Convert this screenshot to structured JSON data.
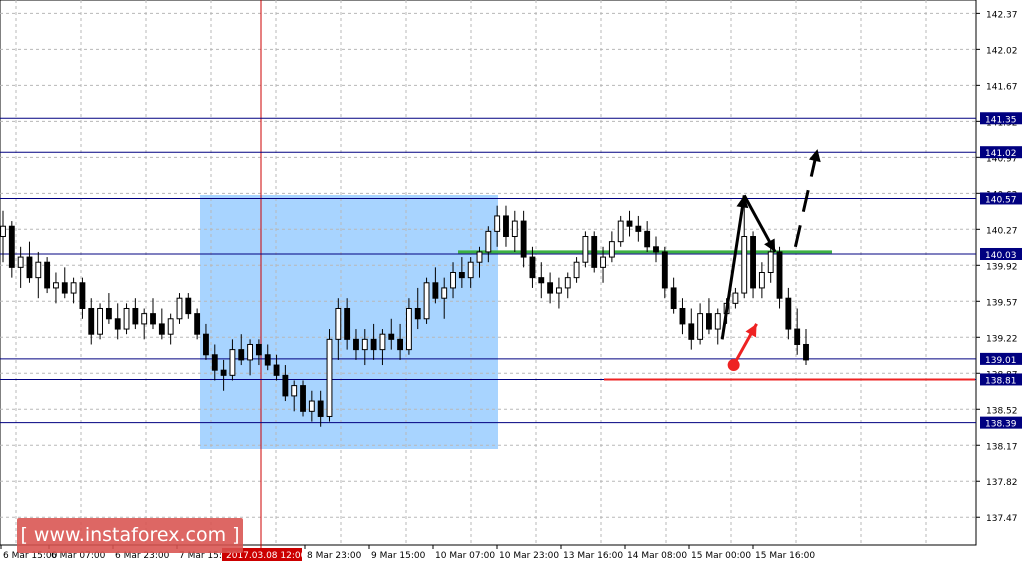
{
  "watermark": "[ www.instaforex.com ]",
  "chart_data": {
    "type": "candlestick",
    "symbol": "",
    "y_axis": {
      "min": 137.2,
      "max": 142.5,
      "ticks": [
        "142.37",
        "142.02",
        "141.67",
        "141.32",
        "140.97",
        "140.62",
        "140.27",
        "139.92",
        "139.57",
        "139.22",
        "138.87",
        "138.52",
        "138.17",
        "137.82",
        "137.47"
      ]
    },
    "x_axis": {
      "labels": [
        "6 Mar 15:00",
        "6 Mar 07:00",
        "6 Mar 23:00",
        "7 Mar 15:00",
        "8 Mar 23:00",
        "9 Mar 15:00",
        "10 Mar 07:00",
        "10 Mar 23:00",
        "13 Mar 16:00",
        "14 Mar 08:00",
        "15 Mar 00:00",
        "15 Mar 16:00"
      ],
      "highlight_label": "2017.03.08 12:00"
    },
    "horizontal_levels": [
      {
        "price": 141.35,
        "label": "141.35",
        "color": "#000080"
      },
      {
        "price": 141.02,
        "label": "141.02",
        "color": "#000080"
      },
      {
        "price": 140.57,
        "label": "140.57",
        "color": "#000080"
      },
      {
        "price": 140.03,
        "label": "140.03",
        "color": "#000080"
      },
      {
        "price": 139.01,
        "label": "139.01",
        "color": "#000080"
      },
      {
        "price": 138.81,
        "label": "138.81",
        "color": "#000080"
      },
      {
        "price": 138.39,
        "label": "138.39",
        "color": "#000080"
      }
    ],
    "green_level": {
      "price": 140.05,
      "color": "#3cb043"
    },
    "red_level": {
      "price": 138.81,
      "color": "#ee2222"
    },
    "vertical_marker_color": "#cc0000",
    "highlight_box_color": "#99ccff",
    "colors": {
      "grid": "#b8b8b8",
      "candle": "#000000",
      "axis_text": "#000000",
      "level_label_bg": "#000080",
      "level_label_text": "#ffffff"
    },
    "ohlc": [
      [
        140.2,
        140.45,
        139.95,
        140.3
      ],
      [
        140.3,
        140.35,
        139.8,
        139.9
      ],
      [
        139.9,
        140.1,
        139.7,
        140.0
      ],
      [
        140.0,
        140.15,
        139.75,
        139.8
      ],
      [
        139.8,
        140.05,
        139.6,
        139.95
      ],
      [
        139.95,
        140.0,
        139.65,
        139.7
      ],
      [
        139.7,
        139.85,
        139.55,
        139.75
      ],
      [
        139.75,
        139.9,
        139.6,
        139.65
      ],
      [
        139.65,
        139.8,
        139.55,
        139.75
      ],
      [
        139.75,
        139.8,
        139.4,
        139.5
      ],
      [
        139.5,
        139.6,
        139.15,
        139.25
      ],
      [
        139.25,
        139.55,
        139.2,
        139.5
      ],
      [
        139.5,
        139.65,
        139.35,
        139.4
      ],
      [
        139.4,
        139.55,
        139.2,
        139.3
      ],
      [
        139.3,
        139.55,
        139.25,
        139.5
      ],
      [
        139.5,
        139.6,
        139.3,
        139.35
      ],
      [
        139.35,
        139.5,
        139.2,
        139.45
      ],
      [
        139.45,
        139.6,
        139.3,
        139.35
      ],
      [
        139.35,
        139.5,
        139.2,
        139.25
      ],
      [
        139.25,
        139.45,
        139.15,
        139.4
      ],
      [
        139.4,
        139.65,
        139.35,
        139.6
      ],
      [
        139.6,
        139.65,
        139.4,
        139.45
      ],
      [
        139.45,
        139.5,
        139.2,
        139.25
      ],
      [
        139.25,
        139.35,
        139.0,
        139.05
      ],
      [
        139.05,
        139.15,
        138.8,
        138.9
      ],
      [
        138.9,
        139.0,
        138.7,
        138.85
      ],
      [
        138.85,
        139.2,
        138.8,
        139.1
      ],
      [
        139.1,
        139.25,
        138.95,
        139.0
      ],
      [
        139.0,
        139.2,
        138.85,
        139.15
      ],
      [
        139.15,
        139.2,
        138.95,
        139.05
      ],
      [
        139.05,
        139.15,
        138.9,
        138.95
      ],
      [
        138.95,
        139.05,
        138.8,
        138.85
      ],
      [
        138.85,
        138.95,
        138.6,
        138.65
      ],
      [
        138.65,
        138.8,
        138.5,
        138.75
      ],
      [
        138.75,
        138.8,
        138.45,
        138.5
      ],
      [
        138.5,
        138.7,
        138.4,
        138.6
      ],
      [
        138.6,
        138.7,
        138.35,
        138.45
      ],
      [
        138.45,
        139.3,
        138.4,
        139.2
      ],
      [
        139.2,
        139.6,
        139.0,
        139.5
      ],
      [
        139.5,
        139.6,
        139.1,
        139.2
      ],
      [
        139.2,
        139.3,
        139.0,
        139.1
      ],
      [
        139.1,
        139.3,
        138.95,
        139.2
      ],
      [
        139.2,
        139.35,
        139.0,
        139.1
      ],
      [
        139.1,
        139.3,
        138.95,
        139.25
      ],
      [
        139.25,
        139.4,
        139.1,
        139.2
      ],
      [
        139.2,
        139.35,
        139.0,
        139.1
      ],
      [
        139.1,
        139.6,
        139.05,
        139.5
      ],
      [
        139.5,
        139.7,
        139.3,
        139.4
      ],
      [
        139.4,
        139.8,
        139.35,
        139.75
      ],
      [
        139.75,
        139.9,
        139.55,
        139.6
      ],
      [
        139.6,
        139.8,
        139.4,
        139.7
      ],
      [
        139.7,
        139.95,
        139.6,
        139.85
      ],
      [
        139.85,
        140.0,
        139.7,
        139.8
      ],
      [
        139.8,
        140.0,
        139.7,
        139.95
      ],
      [
        139.95,
        140.1,
        139.8,
        140.05
      ],
      [
        140.05,
        140.3,
        139.95,
        140.25
      ],
      [
        140.25,
        140.5,
        140.1,
        140.4
      ],
      [
        140.4,
        140.5,
        140.1,
        140.2
      ],
      [
        140.2,
        140.45,
        140.05,
        140.35
      ],
      [
        140.35,
        140.45,
        139.9,
        140.0
      ],
      [
        140.0,
        140.1,
        139.7,
        139.8
      ],
      [
        139.8,
        139.95,
        139.6,
        139.75
      ],
      [
        139.75,
        139.85,
        139.55,
        139.65
      ],
      [
        139.65,
        139.8,
        139.5,
        139.7
      ],
      [
        139.7,
        139.85,
        139.6,
        139.8
      ],
      [
        139.8,
        140.0,
        139.75,
        139.95
      ],
      [
        139.95,
        140.25,
        139.9,
        140.2
      ],
      [
        140.2,
        140.25,
        139.85,
        139.9
      ],
      [
        139.9,
        140.1,
        139.75,
        140.0
      ],
      [
        140.0,
        140.25,
        139.95,
        140.15
      ],
      [
        140.15,
        140.4,
        140.1,
        140.35
      ],
      [
        140.35,
        140.45,
        140.2,
        140.3
      ],
      [
        140.3,
        140.4,
        140.15,
        140.25
      ],
      [
        140.25,
        140.35,
        140.05,
        140.1
      ],
      [
        140.1,
        140.2,
        139.95,
        140.05
      ],
      [
        140.05,
        140.1,
        139.6,
        139.7
      ],
      [
        139.7,
        139.8,
        139.45,
        139.5
      ],
      [
        139.5,
        139.6,
        139.25,
        139.35
      ],
      [
        139.35,
        139.5,
        139.1,
        139.2
      ],
      [
        139.2,
        139.55,
        139.15,
        139.45
      ],
      [
        139.45,
        139.6,
        139.25,
        139.3
      ],
      [
        139.3,
        139.5,
        139.15,
        139.45
      ],
      [
        139.45,
        139.6,
        139.35,
        139.55
      ],
      [
        139.55,
        139.7,
        139.5,
        139.65
      ],
      [
        139.65,
        140.6,
        139.6,
        140.2
      ],
      [
        140.2,
        140.25,
        139.6,
        139.7
      ],
      [
        139.7,
        139.95,
        139.6,
        139.85
      ],
      [
        139.85,
        140.15,
        139.75,
        140.05
      ],
      [
        140.05,
        140.1,
        139.5,
        139.6
      ],
      [
        139.6,
        139.7,
        139.2,
        139.3
      ],
      [
        139.3,
        139.5,
        139.05,
        139.15
      ],
      [
        139.15,
        139.3,
        138.95,
        139.0
      ]
    ],
    "annotations": [
      {
        "type": "arrow",
        "color": "#000000",
        "from": [
          81.5,
          139.2
        ],
        "to": [
          84,
          140.6
        ]
      },
      {
        "type": "arrow",
        "color": "#000000",
        "from": [
          84,
          140.6
        ],
        "to": [
          87.5,
          140.05
        ]
      },
      {
        "type": "dashed-arrow",
        "color": "#000000",
        "from": [
          89.8,
          140.1
        ],
        "to": [
          92.3,
          141.05
        ]
      },
      {
        "type": "arrow-with-dot",
        "color": "#ee2222",
        "from": [
          82.8,
          138.95
        ],
        "to": [
          85.4,
          139.35
        ]
      }
    ]
  }
}
